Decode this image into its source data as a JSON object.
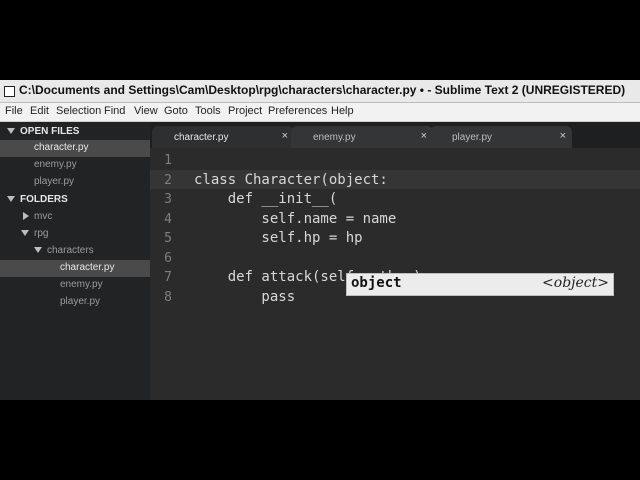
{
  "window": {
    "title": "C:\\Documents and Settings\\Cam\\Desktop\\rpg\\characters\\character.py • - Sublime Text 2 (UNREGISTERED)"
  },
  "menu": [
    "File",
    "Edit",
    "Selection",
    "Find",
    "View",
    "Goto",
    "Tools",
    "Project",
    "Preferences",
    "Help"
  ],
  "sidebar": {
    "open_files_header": "OPEN FILES",
    "open_files": [
      "character.py",
      "enemy.py",
      "player.py"
    ],
    "folders_header": "FOLDERS",
    "folder_mvc": "mvc",
    "folder_rpg": "rpg",
    "folder_characters": "characters",
    "characters_files": [
      "character.py",
      "enemy.py",
      "player.py"
    ]
  },
  "tabs": [
    {
      "label": "character.py",
      "close": "×"
    },
    {
      "label": "enemy.py",
      "close": "×"
    },
    {
      "label": "player.py",
      "close": "×"
    }
  ],
  "editor": {
    "line_numbers": [
      "1",
      "2",
      "3",
      "4",
      "5",
      "6",
      "7",
      "8"
    ],
    "lines": [
      "",
      "class Character(object:",
      "    def __init__(",
      "        self.name = name",
      "        self.hp = hp",
      "",
      "    def attack(self, other):",
      "        pass"
    ]
  },
  "autocomplete": {
    "item": "object",
    "hint": "<object>"
  }
}
